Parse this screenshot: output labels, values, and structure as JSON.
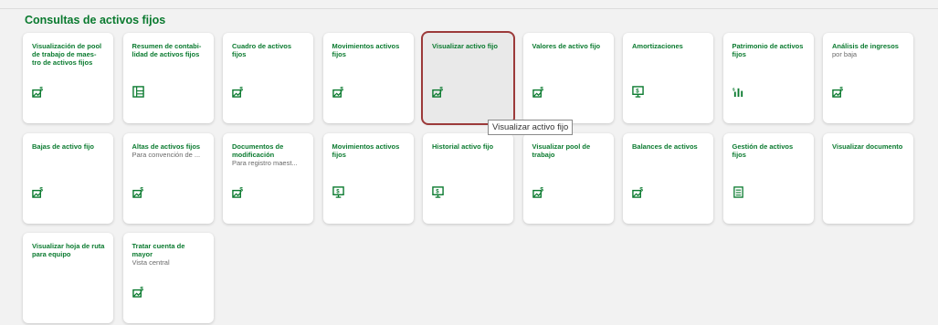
{
  "section": {
    "title": "Consultas de activos fijos"
  },
  "tiles": [
    {
      "title": "Visualización de pool de trabajo de maes-tro de activos fijos",
      "sub": "",
      "icon": "asset-dollar-icon"
    },
    {
      "title": "Resumen de contabi-lidad de activos fijos",
      "sub": "",
      "icon": "ledger-icon"
    },
    {
      "title": "Cuadro de activos fijos",
      "sub": "",
      "icon": "asset-dollar-icon"
    },
    {
      "title": "Movimientos activos fijos",
      "sub": "",
      "icon": "asset-dollar-icon"
    },
    {
      "title": "Visualizar activo fijo",
      "sub": "",
      "icon": "asset-dollar-icon"
    },
    {
      "title": "Valores de activo fijo",
      "sub": "",
      "icon": "asset-dollar-icon"
    },
    {
      "title": "Amortizaciones",
      "sub": "",
      "icon": "monitor-dollar-icon"
    },
    {
      "title": "Patrimonio de activos fijos",
      "sub": "",
      "icon": "dollar-bars-icon"
    },
    {
      "title": "Análisis de ingresos",
      "sub": "por baja",
      "icon": "asset-dollar-icon"
    },
    {
      "title": "Bajas de activo fijo",
      "sub": "",
      "icon": "asset-dollar-icon"
    },
    {
      "title": "Altas de activos fijos",
      "sub": "Para convención de ...",
      "icon": "asset-dollar-icon"
    },
    {
      "title": "Documentos de modificación",
      "sub": "Para registro maest...",
      "icon": "asset-dollar-icon"
    },
    {
      "title": "Movimientos activos fijos",
      "sub": "",
      "icon": "monitor-dollar-icon"
    },
    {
      "title": "Historial activo fijo",
      "sub": "",
      "icon": "monitor-dollar-icon"
    },
    {
      "title": "Visualizar pool de trabajo",
      "sub": "",
      "icon": "asset-dollar-icon"
    },
    {
      "title": "Balances de activos",
      "sub": "",
      "icon": "asset-dollar-icon"
    },
    {
      "title": "Gestión de activos fijos",
      "sub": "",
      "icon": "checklist-icon"
    },
    {
      "title": "Visualizar documento",
      "sub": "",
      "icon": ""
    },
    {
      "title": "Visualizar hoja de ruta para equipo",
      "sub": "",
      "icon": ""
    },
    {
      "title": "Tratar cuenta de mayor",
      "sub": "Vista central",
      "icon": "asset-dollar-icon"
    }
  ],
  "tooltip": {
    "text": "Visualizar activo fijo"
  },
  "colors": {
    "accent": "#0a7a2f",
    "selected_border": "#9c3a3a"
  }
}
